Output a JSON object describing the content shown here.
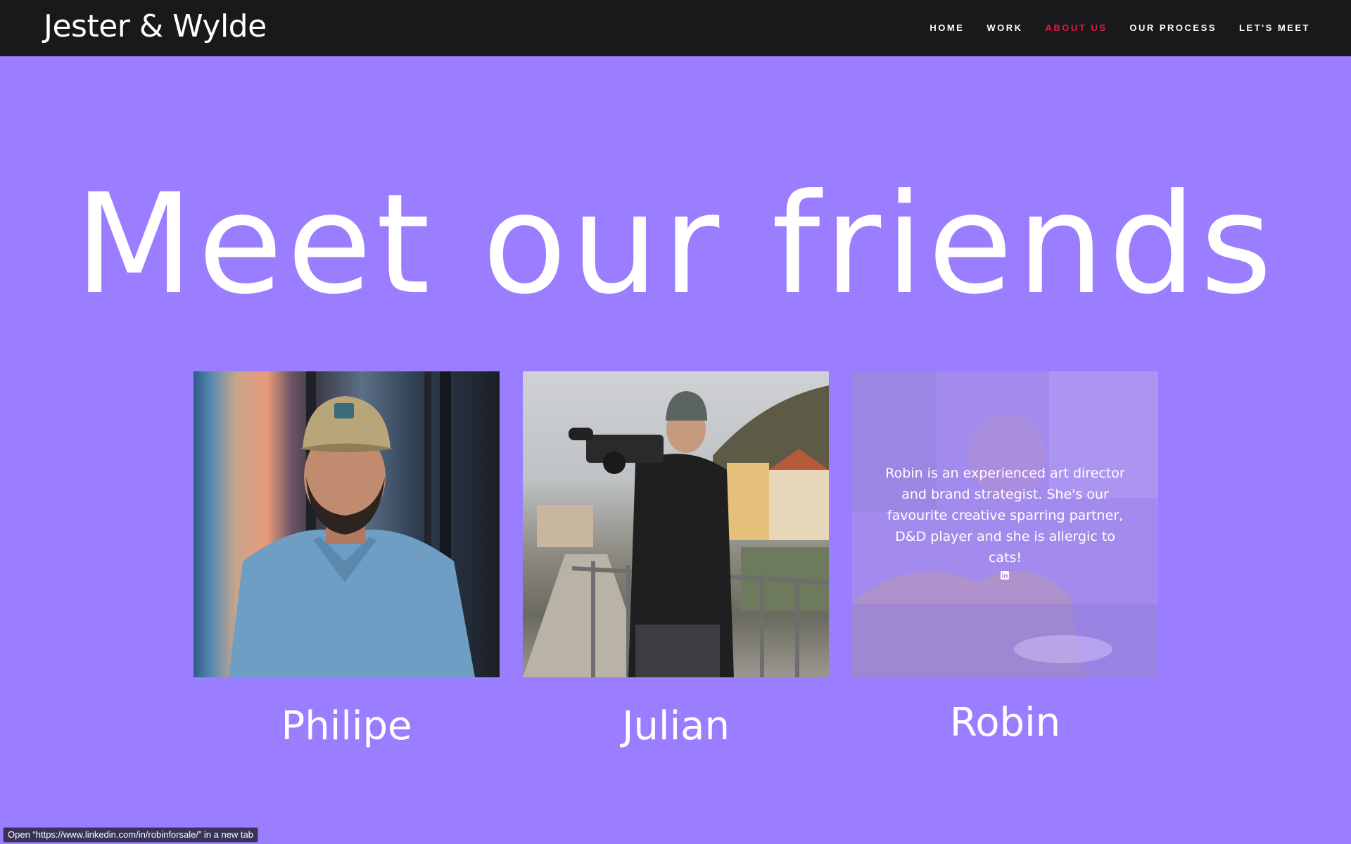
{
  "header": {
    "logo": "Jester & Wylde",
    "nav": [
      "HOME",
      "WORK",
      "ABOUT US",
      "OUR PROCESS",
      "LET'S MEET"
    ],
    "active_nav": "ABOUT US"
  },
  "title": "Meet our friends",
  "cards": [
    {
      "name": "Philipe"
    },
    {
      "name": "Julian"
    },
    {
      "name": "Robin",
      "bio": "Robin is an experienced art director and brand strategist. She's our favourite creative sparring partner, D&D player and she is allergic to cats!",
      "icon": "linkedin-icon"
    }
  ],
  "status_bar": "Open “https://www.linkedin.com/in/robinforsale/” in a new tab",
  "colors": {
    "background": "#9b7dff",
    "header": "#19191b",
    "nav_active": "#e3193f"
  }
}
